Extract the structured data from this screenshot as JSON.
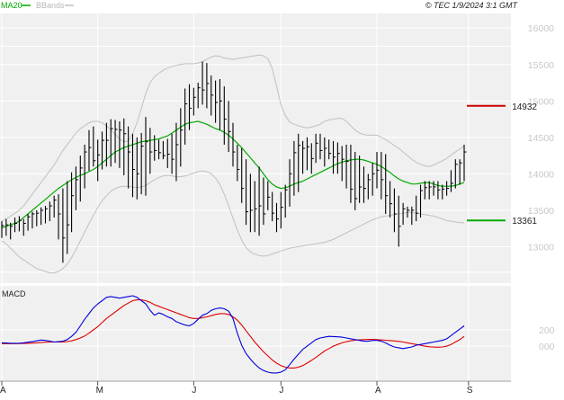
{
  "header": {
    "legend_ma": "MA20",
    "legend_bb": "BBands",
    "source": "© TEC 1/9/2024 3:1 GMT"
  },
  "colors": {
    "panel_bg": "#f0f0f0",
    "grid": "#ffffff",
    "price": "#000000",
    "ma20": "#00aa00",
    "bbands": "#c0c0c0",
    "macd": "#0000dd",
    "signal": "#dd0000",
    "resistance": "#cc0000",
    "support": "#00aa00",
    "axis_text": "#c8c8c8",
    "label_text": "#222222"
  },
  "chart_data": [
    {
      "type": "line",
      "panel": "price",
      "y_ticks": [
        "16000",
        "15500",
        "15000",
        "14500",
        "14000",
        "13500",
        "13000"
      ],
      "ylim": [
        12500,
        16200
      ],
      "x_labels": [
        "A",
        "M",
        "J",
        "J",
        "A",
        "S"
      ],
      "x_label_index": [
        0,
        22,
        44,
        64,
        86,
        107
      ],
      "levels": [
        {
          "name": "resistance",
          "value": 14932,
          "label": "14932"
        },
        {
          "name": "support",
          "value": 13361,
          "label": "13361"
        }
      ],
      "series": [
        {
          "name": "MA20",
          "kind": "line",
          "values": [
            13260,
            13280,
            13300,
            13320,
            13350,
            13400,
            13450,
            13500,
            13550,
            13600,
            13650,
            13700,
            13750,
            13800,
            13840,
            13880,
            13920,
            13950,
            13980,
            14000,
            14030,
            14060,
            14100,
            14150,
            14200,
            14250,
            14300,
            14330,
            14360,
            14380,
            14400,
            14420,
            14440,
            14450,
            14460,
            14470,
            14480,
            14500,
            14520,
            14560,
            14600,
            14640,
            14680,
            14700,
            14710,
            14720,
            14700,
            14680,
            14650,
            14620,
            14600,
            14570,
            14530,
            14480,
            14420,
            14360,
            14290,
            14220,
            14150,
            14080,
            14000,
            13920,
            13860,
            13820,
            13800,
            13810,
            13830,
            13860,
            13880,
            13900,
            13930,
            13960,
            13990,
            14020,
            14050,
            14080,
            14110,
            14140,
            14160,
            14180,
            14190,
            14200,
            14200,
            14190,
            14170,
            14150,
            14130,
            14100,
            14060,
            14020,
            13970,
            13930,
            13900,
            13880,
            13860,
            13860,
            13870,
            13880,
            13880,
            13860,
            13840,
            13830,
            13830,
            13830,
            13840,
            13860,
            13880
          ]
        },
        {
          "name": "BBands upper",
          "kind": "line",
          "values": [
            13350,
            13380,
            13420,
            13460,
            13500,
            13560,
            13640,
            13720,
            13800,
            13880,
            13960,
            14040,
            14120,
            14220,
            14320,
            14400,
            14480,
            14560,
            14620,
            14660,
            14700,
            14720,
            14720,
            14700,
            14660,
            14600,
            14540,
            14480,
            14440,
            14450,
            14550,
            14700,
            14900,
            15100,
            15250,
            15330,
            15380,
            15420,
            15450,
            15470,
            15490,
            15500,
            15510,
            15510,
            15510,
            15520,
            15540,
            15570,
            15600,
            15620,
            15610,
            15590,
            15580,
            15570,
            15580,
            15590,
            15600,
            15610,
            15620,
            15630,
            15620,
            15580,
            15450,
            15200,
            14950,
            14800,
            14710,
            14680,
            14660,
            14640,
            14630,
            14640,
            14660,
            14680,
            14720,
            14740,
            14750,
            14760,
            14760,
            14720,
            14660,
            14600,
            14560,
            14540,
            14530,
            14530,
            14530,
            14500,
            14470,
            14430,
            14390,
            14350,
            14300,
            14250,
            14200,
            14160,
            14130,
            14110,
            14100,
            14120,
            14150,
            14180,
            14210,
            14260,
            14300,
            14340,
            14380
          ]
        },
        {
          "name": "BBands lower",
          "kind": "line",
          "values": [
            13080,
            13040,
            12980,
            12920,
            12860,
            12820,
            12780,
            12740,
            12700,
            12680,
            12660,
            12640,
            12640,
            12660,
            12700,
            12760,
            12850,
            12960,
            13080,
            13200,
            13320,
            13430,
            13540,
            13630,
            13700,
            13760,
            13800,
            13820,
            13830,
            13830,
            13820,
            13810,
            13820,
            13840,
            13880,
            13920,
            13950,
            13970,
            13980,
            13970,
            13960,
            13960,
            13970,
            13990,
            14010,
            14030,
            14040,
            14030,
            14000,
            13940,
            13850,
            13720,
            13560,
            13390,
            13230,
            13090,
            12990,
            12930,
            12900,
            12880,
            12870,
            12880,
            12900,
            12920,
            12940,
            12960,
            12980,
            12990,
            13000,
            13010,
            13020,
            13030,
            13040,
            13050,
            13060,
            13080,
            13100,
            13130,
            13160,
            13190,
            13220,
            13250,
            13280,
            13310,
            13340,
            13370,
            13390,
            13410,
            13420,
            13430,
            13440,
            13450,
            13460,
            13470,
            13470,
            13460,
            13450,
            13440,
            13430,
            13420,
            13400,
            13380,
            13360,
            13350,
            13340,
            13330,
            13330
          ]
        },
        {
          "name": "OHLC",
          "kind": "ohlc",
          "high": [
            13350,
            13380,
            13330,
            13400,
            13420,
            13380,
            13450,
            13480,
            13500,
            13540,
            13560,
            13620,
            13700,
            13720,
            13800,
            13900,
            14020,
            14100,
            14250,
            14400,
            14600,
            14650,
            14470,
            14580,
            14700,
            14750,
            14740,
            14720,
            14760,
            14650,
            14550,
            14500,
            14560,
            14780,
            14630,
            14530,
            14470,
            14450,
            14480,
            14550,
            14700,
            14900,
            15170,
            15230,
            15180,
            15250,
            15540,
            15520,
            15350,
            15280,
            15300,
            15200,
            15000,
            14700,
            14400,
            14350,
            14200,
            14000,
            13900,
            14100,
            13950,
            13900,
            13750,
            13600,
            13750,
            13850,
            14200,
            14450,
            14550,
            14450,
            14500,
            14420,
            14550,
            14550,
            14500,
            14470,
            14450,
            14430,
            14380,
            14400,
            14400,
            14300,
            14250,
            14100,
            14000,
            14150,
            14300,
            14300,
            14270,
            13900,
            13800,
            13700,
            13600,
            13550,
            13550,
            13700,
            13850,
            13900,
            13900,
            13900,
            13900,
            13850,
            13900,
            14050,
            14200,
            14200,
            14400
          ],
          "low": [
            13120,
            13150,
            13100,
            13200,
            13210,
            13150,
            13220,
            13250,
            13280,
            13300,
            13320,
            13350,
            13400,
            13100,
            12780,
            12900,
            13200,
            13500,
            13620,
            13800,
            14040,
            14100,
            13900,
            14060,
            14100,
            14100,
            14150,
            14080,
            13980,
            13800,
            13680,
            13650,
            13720,
            13700,
            14000,
            14180,
            14200,
            14200,
            14080,
            14000,
            13900,
            14100,
            14400,
            14600,
            14800,
            14900,
            14950,
            14900,
            14800,
            14700,
            14600,
            14400,
            14300,
            14100,
            13900,
            13600,
            13300,
            13200,
            13200,
            13150,
            13300,
            13500,
            13350,
            13200,
            13250,
            13400,
            13550,
            13700,
            13750,
            14000,
            14050,
            14000,
            14150,
            14200,
            14100,
            14200,
            14000,
            14000,
            13900,
            13800,
            13600,
            13500,
            13600,
            13600,
            13650,
            13700,
            13800,
            13650,
            13450,
            13400,
            13200,
            13000,
            13300,
            13400,
            13300,
            13350,
            13400,
            13650,
            13650,
            13700,
            13650,
            13650,
            13700,
            13750,
            13800,
            13850,
            13900
          ],
          "close": [
            13290,
            13300,
            13280,
            13320,
            13360,
            13320,
            13410,
            13450,
            13460,
            13500,
            13520,
            13560,
            13640,
            13450,
            13120,
            13300,
            13700,
            13920,
            14080,
            14300,
            14360,
            14180,
            14260,
            14460,
            14460,
            14620,
            14610,
            14600,
            14550,
            14300,
            14060,
            14000,
            14380,
            14440,
            14300,
            14320,
            14290,
            14250,
            14270,
            14200,
            14400,
            14600,
            14960,
            14900,
            15050,
            15180,
            15150,
            15240,
            15080,
            14980,
            15000,
            14750,
            14580,
            14300,
            14060,
            13800,
            13480,
            13500,
            13520,
            13560,
            13450,
            13680,
            13460,
            13380,
            13540,
            13780,
            14000,
            14290,
            14390,
            14350,
            14370,
            14210,
            14420,
            14320,
            14350,
            14280,
            14230,
            14280,
            14200,
            14170,
            13790,
            13660,
            13820,
            13800,
            13920,
            14000,
            14050,
            13920,
            13700,
            13590,
            13450,
            13280,
            13520,
            13500,
            13500,
            13460,
            13770,
            13810,
            13820,
            13820,
            13780,
            13790,
            13800,
            13870,
            14130,
            14150,
            14300
          ]
        }
      ]
    },
    {
      "type": "line",
      "panel": "macd",
      "y_ticks": [
        "200",
        "000"
      ],
      "ylim": [
        -420,
        720
      ],
      "series": [
        {
          "name": "MACD",
          "values": [
            40,
            38,
            35,
            35,
            36,
            40,
            48,
            55,
            65,
            75,
            70,
            60,
            50,
            55,
            60,
            80,
            120,
            170,
            250,
            330,
            400,
            470,
            520,
            560,
            600,
            610,
            600,
            590,
            600,
            610,
            620,
            600,
            560,
            520,
            440,
            380,
            410,
            390,
            360,
            340,
            300,
            280,
            260,
            250,
            280,
            330,
            380,
            400,
            440,
            460,
            470,
            460,
            430,
            340,
            160,
            10,
            -90,
            -160,
            -220,
            -270,
            -300,
            -320,
            -330,
            -330,
            -320,
            -290,
            -230,
            -160,
            -100,
            -40,
            0,
            40,
            80,
            100,
            110,
            120,
            118,
            115,
            110,
            100,
            90,
            80,
            70,
            60,
            60,
            70,
            70,
            60,
            40,
            10,
            -10,
            -20,
            -30,
            -20,
            -10,
            10,
            20,
            30,
            40,
            50,
            60,
            70,
            90,
            130,
            170,
            210,
            250
          ]
        },
        {
          "name": "Signal",
          "values": [
            30,
            30,
            30,
            31,
            32,
            33,
            35,
            37,
            40,
            44,
            48,
            50,
            50,
            51,
            52,
            56,
            65,
            80,
            100,
            125,
            160,
            200,
            240,
            290,
            340,
            380,
            420,
            460,
            500,
            530,
            560,
            570,
            570,
            560,
            540,
            510,
            490,
            470,
            450,
            430,
            410,
            390,
            370,
            350,
            340,
            340,
            350,
            360,
            375,
            390,
            400,
            400,
            390,
            360,
            320,
            260,
            190,
            120,
            50,
            -10,
            -70,
            -120,
            -170,
            -210,
            -240,
            -260,
            -270,
            -270,
            -260,
            -240,
            -210,
            -175,
            -140,
            -100,
            -60,
            -30,
            0,
            20,
            40,
            55,
            65,
            72,
            78,
            80,
            82,
            82,
            80,
            76,
            72,
            68,
            64,
            58,
            50,
            40,
            30,
            20,
            10,
            0,
            -8,
            -12,
            -14,
            -10,
            0,
            20,
            50,
            80,
            120
          ]
        }
      ]
    }
  ]
}
